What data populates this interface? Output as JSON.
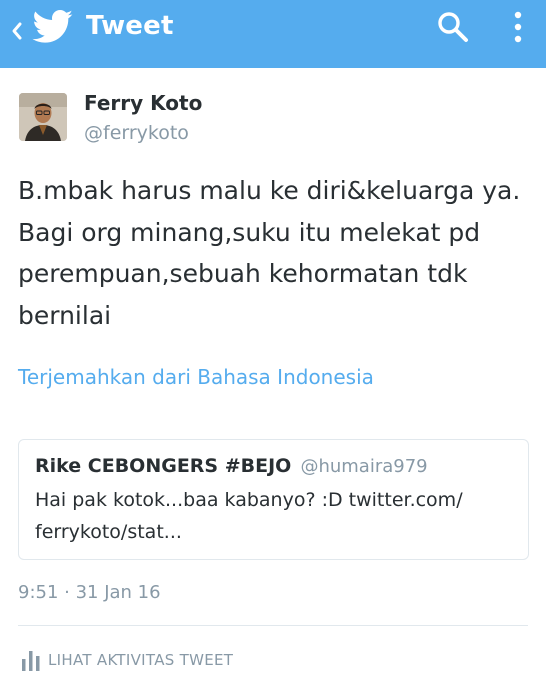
{
  "appbar": {
    "title": "Tweet",
    "background_color": "#55acee",
    "icons": [
      "back-chevron-icon",
      "twitter-bird-icon",
      "search-icon",
      "overflow-menu-icon"
    ]
  },
  "tweet": {
    "author_name": "Ferry Koto",
    "author_handle": "@ferrykoto",
    "text": "B.mbak harus malu ke diri&keluarga ya. Bagi org minang,suku itu melekat pd perempuan,sebuah kehormatan tdk bernilai",
    "translate_label": "Terjemahkan dari Bahasa Indonesia",
    "timestamp": "9:51 · 31 Jan 16"
  },
  "quoted_tweet": {
    "author_name": "Rike CEBONGERS #BEJO",
    "author_handle": "@humaira979",
    "text": "Hai pak kotok...baa kabanyo? :D twitter.com/ ferrykoto/stat..."
  },
  "activity": {
    "label": "LIHAT AKTIVITAS TWEET",
    "icon": "bar-chart-icon"
  },
  "colors": {
    "accent": "#55acee",
    "text": "#292f33",
    "secondary_text": "#8899a6",
    "border": "#e1e8ed"
  }
}
